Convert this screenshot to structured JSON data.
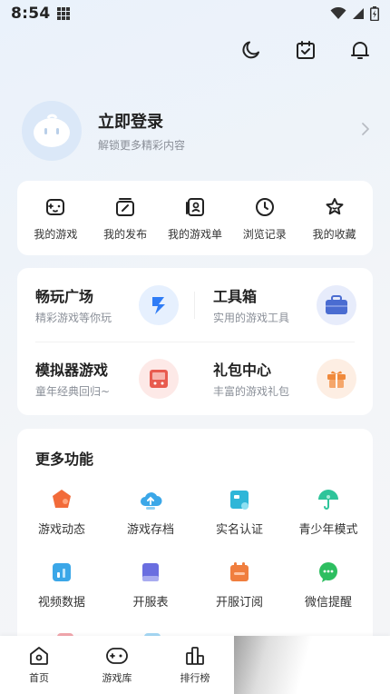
{
  "status_bar": {
    "time": "8:54"
  },
  "profile": {
    "title": "立即登录",
    "subtitle": "解锁更多精彩内容"
  },
  "quick_links": [
    {
      "label": "我的游戏",
      "icon": "gamepad-face-icon"
    },
    {
      "label": "我的发布",
      "icon": "edit-icon"
    },
    {
      "label": "我的游戏单",
      "icon": "playlist-icon"
    },
    {
      "label": "浏览记录",
      "icon": "clock-icon"
    },
    {
      "label": "我的收藏",
      "icon": "star-icon"
    }
  ],
  "features": [
    {
      "title": "畅玩广场",
      "subtitle": "精彩游戏等你玩",
      "icon": "lightning-play-icon",
      "color": "#2f7cf6"
    },
    {
      "title": "工具箱",
      "subtitle": "实用的游戏工具",
      "icon": "toolbox-icon",
      "color": "#4a6cd1"
    },
    {
      "title": "模拟器游戏",
      "subtitle": "童年经典回归~",
      "icon": "arcade-icon",
      "color": "#e85b4f"
    },
    {
      "title": "礼包中心",
      "subtitle": "丰富的游戏礼包",
      "icon": "gift-icon",
      "color": "#f08a3c"
    }
  ],
  "more": {
    "title": "更多功能",
    "items": [
      {
        "label": "游戏动态",
        "icon": "dynamic-icon",
        "color": "#f26b3a"
      },
      {
        "label": "游戏存档",
        "icon": "cloud-upload-icon",
        "color": "#3ba7e8"
      },
      {
        "label": "实名认证",
        "icon": "id-card-icon",
        "color": "#2fb6d8"
      },
      {
        "label": "青少年模式",
        "icon": "umbrella-icon",
        "color": "#2ec49a"
      },
      {
        "label": "视频数据",
        "icon": "chart-icon",
        "color": "#3ba7e8"
      },
      {
        "label": "开服表",
        "icon": "list-icon",
        "color": "#6a6ee0"
      },
      {
        "label": "开服订阅",
        "icon": "calendar-icon",
        "color": "#f07e3e"
      },
      {
        "label": "微信提醒",
        "icon": "wechat-icon",
        "color": "#2dbe60"
      }
    ]
  },
  "tabs": [
    {
      "label": "首页",
      "icon": "home-icon"
    },
    {
      "label": "游戏库",
      "icon": "gamepad-icon"
    },
    {
      "label": "排行榜",
      "icon": "podium-icon"
    }
  ]
}
